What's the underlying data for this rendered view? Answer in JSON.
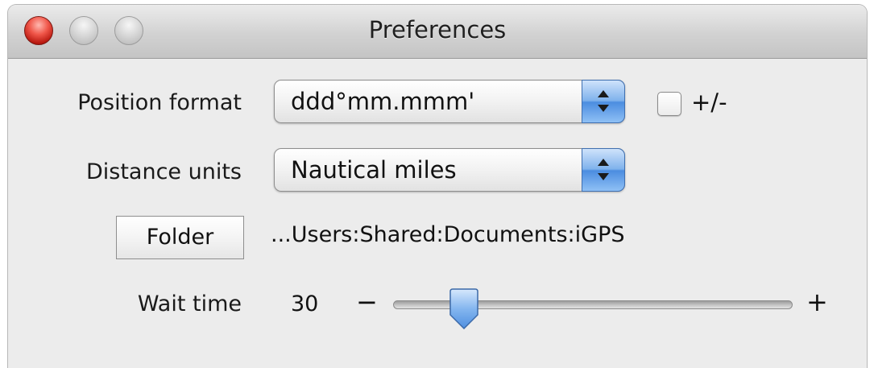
{
  "window": {
    "title": "Preferences"
  },
  "position_format": {
    "label": "Position format",
    "value": "ddd°mm.mmm'",
    "checkbox_label": "+/-",
    "checkbox_checked": false
  },
  "distance_units": {
    "label": "Distance units",
    "value": "Nautical miles"
  },
  "folder": {
    "button_label": "Folder",
    "path": "...Users:Shared:Documents:iGPS"
  },
  "wait_time": {
    "label": "Wait time",
    "value": "30",
    "minus_label": "−",
    "plus_label": "+",
    "slider_fraction": 0.15
  },
  "colors": {
    "close_button": "#e0463a",
    "stepper_accent": "#5b9be6",
    "window_background": "#ececec"
  }
}
